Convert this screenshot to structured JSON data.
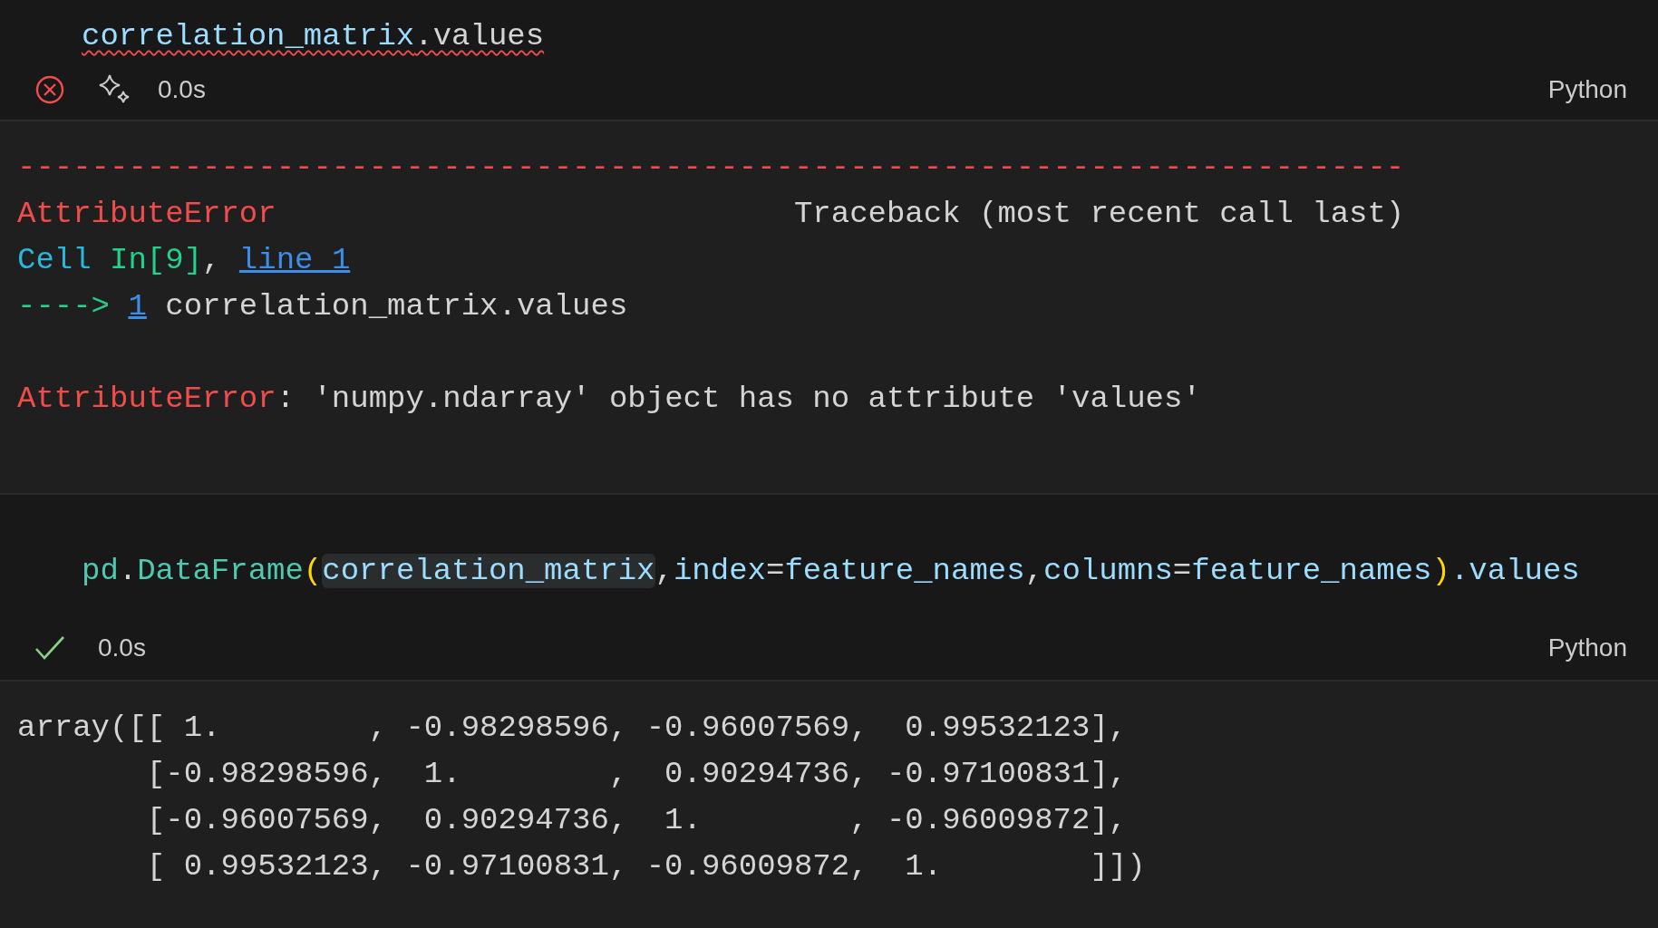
{
  "cells": [
    {
      "code": {
        "squiggle": true,
        "tokens": [
          {
            "text": "correlation_matrix",
            "kind": "var"
          },
          {
            "text": ".values",
            "kind": "plain"
          }
        ]
      },
      "status": {
        "kind": "error",
        "time": "0.0s",
        "language": "Python"
      },
      "output_blocks": [
        {
          "lines": [
            {
              "tokens": [
                {
                  "text": "---------------------------------------------------------------------------",
                  "kind": "red"
                }
              ]
            },
            {
              "tokens": [
                {
                  "text": "AttributeError",
                  "kind": "red"
                },
                {
                  "text": "                            Traceback (most recent call last)",
                  "kind": "plain"
                }
              ]
            },
            {
              "tokens": [
                {
                  "text": "Cell",
                  "kind": "cyan"
                },
                {
                  "text": " In[9]",
                  "kind": "green"
                },
                {
                  "text": ", ",
                  "kind": "plain"
                },
                {
                  "text": "line 1",
                  "kind": "link"
                }
              ]
            },
            {
              "tokens": [
                {
                  "text": "----> ",
                  "kind": "green"
                },
                {
                  "text": "1",
                  "kind": "link"
                },
                {
                  "text": " correlation_matrix.values",
                  "kind": "plain"
                }
              ]
            }
          ]
        },
        {
          "lines": [
            {
              "tokens": [
                {
                  "text": "AttributeError",
                  "kind": "red"
                },
                {
                  "text": ": 'numpy.ndarray' object has no attribute 'values'",
                  "kind": "plain"
                }
              ]
            }
          ]
        }
      ]
    },
    {
      "code": {
        "squiggle": false,
        "tokens": [
          {
            "text": "pd",
            "kind": "class"
          },
          {
            "text": ".",
            "kind": "plain"
          },
          {
            "text": "DataFrame",
            "kind": "class"
          },
          {
            "text": "(",
            "kind": "bracket"
          },
          {
            "text": "correlation_matrix",
            "kind": "var",
            "highlighted": true
          },
          {
            "text": ",",
            "kind": "plain"
          },
          {
            "text": "index",
            "kind": "var"
          },
          {
            "text": "=",
            "kind": "plain"
          },
          {
            "text": "feature_names",
            "kind": "var"
          },
          {
            "text": ",",
            "kind": "plain"
          },
          {
            "text": "columns",
            "kind": "var"
          },
          {
            "text": "=",
            "kind": "plain"
          },
          {
            "text": "feature_names",
            "kind": "var"
          },
          {
            "text": ")",
            "kind": "bracket"
          },
          {
            "text": ".values",
            "kind": "var"
          }
        ]
      },
      "status": {
        "kind": "success",
        "time": "0.0s",
        "language": "Python"
      },
      "output_blocks": [
        {
          "lines": [
            {
              "tokens": [
                {
                  "text": "array([[ 1.        , -0.98298596, -0.96007569,  0.99532123],",
                  "kind": "plain"
                }
              ]
            },
            {
              "tokens": [
                {
                  "text": "       [-0.98298596,  1.        ,  0.90294736, -0.97100831],",
                  "kind": "plain"
                }
              ]
            },
            {
              "tokens": [
                {
                  "text": "       [-0.96007569,  0.90294736,  1.        , -0.96009872],",
                  "kind": "plain"
                }
              ]
            },
            {
              "tokens": [
                {
                  "text": "       [ 0.99532123, -0.97100831, -0.96009872,  1.        ]])",
                  "kind": "plain"
                }
              ]
            }
          ]
        }
      ]
    }
  ]
}
